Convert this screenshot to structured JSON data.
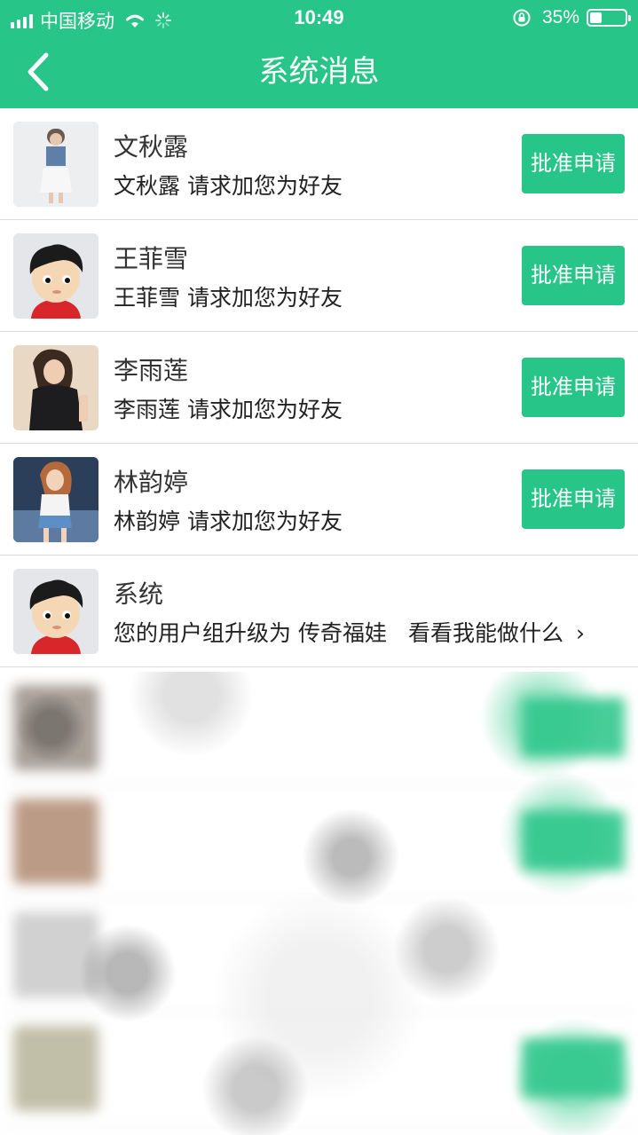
{
  "status_bar": {
    "carrier": "中国移动",
    "time": "10:49",
    "battery_percent": "35%",
    "battery_level": 0.35
  },
  "nav": {
    "title": "系统消息"
  },
  "colors": {
    "accent": "#27c587"
  },
  "messages": [
    {
      "name": "文秋露",
      "text": "文秋露 请求加您为好友",
      "action": "批准申请",
      "avatar": "photo-woman-blue-top"
    },
    {
      "name": "王菲雪",
      "text": "王菲雪 请求加您为好友",
      "action": "批准申请",
      "avatar": "cartoon-default-avatar"
    },
    {
      "name": "李雨莲",
      "text": "李雨莲 请求加您为好友",
      "action": "批准申请",
      "avatar": "photo-woman-black-top"
    },
    {
      "name": "林韵婷",
      "text": "林韵婷 请求加您为好友",
      "action": "批准申请",
      "avatar": "photo-woman-white-top"
    },
    {
      "name": "系统",
      "text": "您的用户组升级为 传奇福娃",
      "link": "看看我能做什么",
      "chevron": "›",
      "avatar": "cartoon-default-avatar"
    }
  ]
}
